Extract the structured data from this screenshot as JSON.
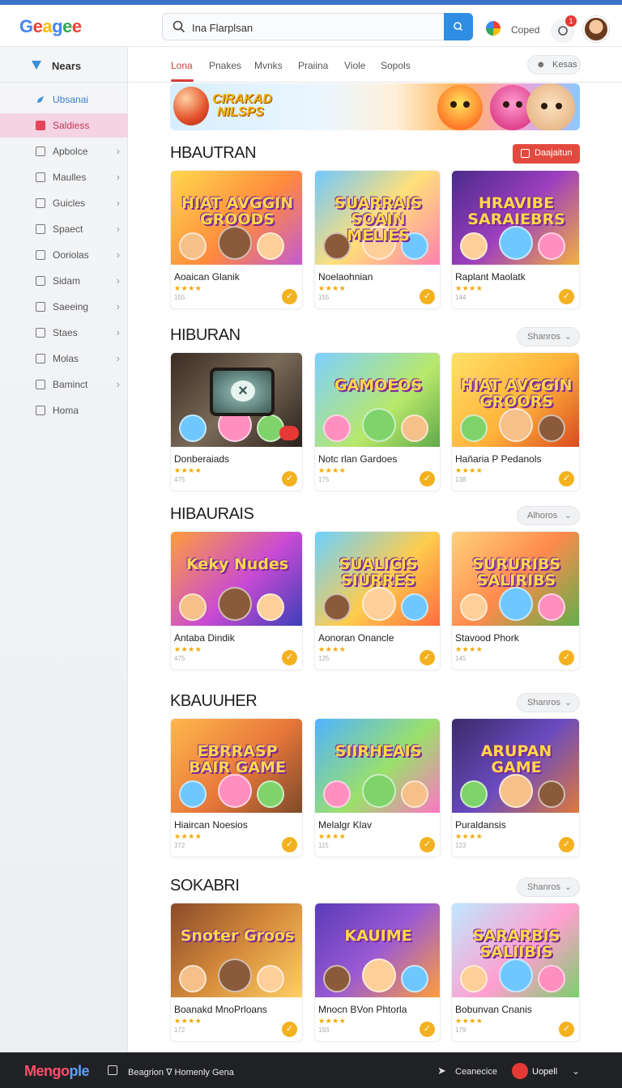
{
  "header": {
    "logo": "Geagee",
    "search_value": "Ina Flarplsan",
    "profile_label": "Coped",
    "notification_count": "1"
  },
  "sidebar": {
    "title": "Nears",
    "items": [
      {
        "label": "Ubsanai",
        "chevron": false,
        "state": "highlight"
      },
      {
        "label": "Saldiess",
        "chevron": false,
        "state": "selected"
      },
      {
        "label": "Apbolce",
        "chevron": true,
        "state": ""
      },
      {
        "label": "Maulles",
        "chevron": true,
        "state": ""
      },
      {
        "label": "Guicles",
        "chevron": true,
        "state": ""
      },
      {
        "label": "Spaect",
        "chevron": true,
        "state": ""
      },
      {
        "label": "Ooriolas",
        "chevron": true,
        "state": ""
      },
      {
        "label": "Sidam",
        "chevron": true,
        "state": ""
      },
      {
        "label": "Saeeing",
        "chevron": true,
        "state": ""
      },
      {
        "label": "Staes",
        "chevron": true,
        "state": ""
      },
      {
        "label": "Molas",
        "chevron": true,
        "state": ""
      },
      {
        "label": "Baminct",
        "chevron": true,
        "state": ""
      },
      {
        "label": "Homa",
        "chevron": false,
        "state": ""
      }
    ]
  },
  "tabs": {
    "items": [
      "Lona",
      "Pnakes",
      "Mvnks",
      "Praiina",
      "Viole",
      "Sopols"
    ],
    "active": 0,
    "right_button": "Kesas"
  },
  "banner": {
    "title_line1": "CIRAKAD",
    "title_line2": "NILSPS"
  },
  "sections": [
    {
      "title": "HBAUTRAN",
      "action": {
        "type": "button",
        "label": "Daajaitun"
      },
      "games": [
        {
          "name": "Aoaican Glanik",
          "count": "155",
          "art": "HIAT AVGGIN GROODS",
          "theme": "t1"
        },
        {
          "name": "Noelaohnian",
          "count": "155",
          "art": "SUARRAIS SOAIN MELIES",
          "theme": "t2"
        },
        {
          "name": "Raplant Maolatk",
          "count": "144",
          "art": "HRAVIBE SARAIEBRS",
          "theme": "t3"
        }
      ]
    },
    {
      "title": "HIBURAN",
      "action": {
        "type": "dropdown",
        "label": "Shanros"
      },
      "games": [
        {
          "name": "Donberaiads",
          "count": "475",
          "art": "",
          "theme": "t4"
        },
        {
          "name": "Notc rlan Gardoes",
          "count": "175",
          "art": "GAMOEOS",
          "theme": "t5"
        },
        {
          "name": "Haňaria P Pedanols",
          "count": "138",
          "art": "HIAT AVGGIN GROORS",
          "theme": "t6"
        }
      ]
    },
    {
      "title": "HIBAURAIS",
      "action": {
        "type": "dropdown",
        "label": "Alhoros"
      },
      "games": [
        {
          "name": "Antaba Dindik",
          "count": "475",
          "art": "Keky Nudes",
          "theme": "t7"
        },
        {
          "name": "Aonoran Onancle",
          "count": "125",
          "art": "SUALICIS SIURRES",
          "theme": "t8"
        },
        {
          "name": "Stavood Phork",
          "count": "145",
          "art": "SURURIBS SALIRIBS",
          "theme": "t9"
        }
      ]
    },
    {
      "title": "KBAUUHER",
      "action": {
        "type": "dropdown",
        "label": "Shanros"
      },
      "games": [
        {
          "name": "Hiaircan Noesios",
          "count": "372",
          "art": "EBRRASP BAIR GAME",
          "theme": "t10"
        },
        {
          "name": "Melalgr Klav",
          "count": "115",
          "art": "SIIRHEAIS",
          "theme": "t11"
        },
        {
          "name": "Puraldansis",
          "count": "123",
          "art": "ARUPAN GAME",
          "theme": "t12"
        }
      ]
    },
    {
      "title": "SOKABRI",
      "action": {
        "type": "dropdown",
        "label": "Shanros"
      },
      "games": [
        {
          "name": "Boanakd MnoPrloans",
          "count": "172",
          "art": "Snoter Groos",
          "theme": "t13"
        },
        {
          "name": "Mnocn BVon Phtorla",
          "count": "193",
          "art": "KAUIME",
          "theme": "t14"
        },
        {
          "name": "Bobunvan Cnanis",
          "count": "179",
          "art": "SARARBIS SALIIBIS",
          "theme": "t15"
        }
      ]
    }
  ],
  "bottom_bar": {
    "logo_part1": "Mengo",
    "logo_part2": "ple",
    "text": "Beagrion ∇ Homenly Gena",
    "right_text": "Ceanecice",
    "user_label": "Uopell"
  },
  "colors": {
    "accent": "#d63c3c",
    "search_button": "#2f8de4",
    "selected_bg": "#f4d3e3",
    "star": "#f2a900",
    "check": "#f3b120"
  }
}
